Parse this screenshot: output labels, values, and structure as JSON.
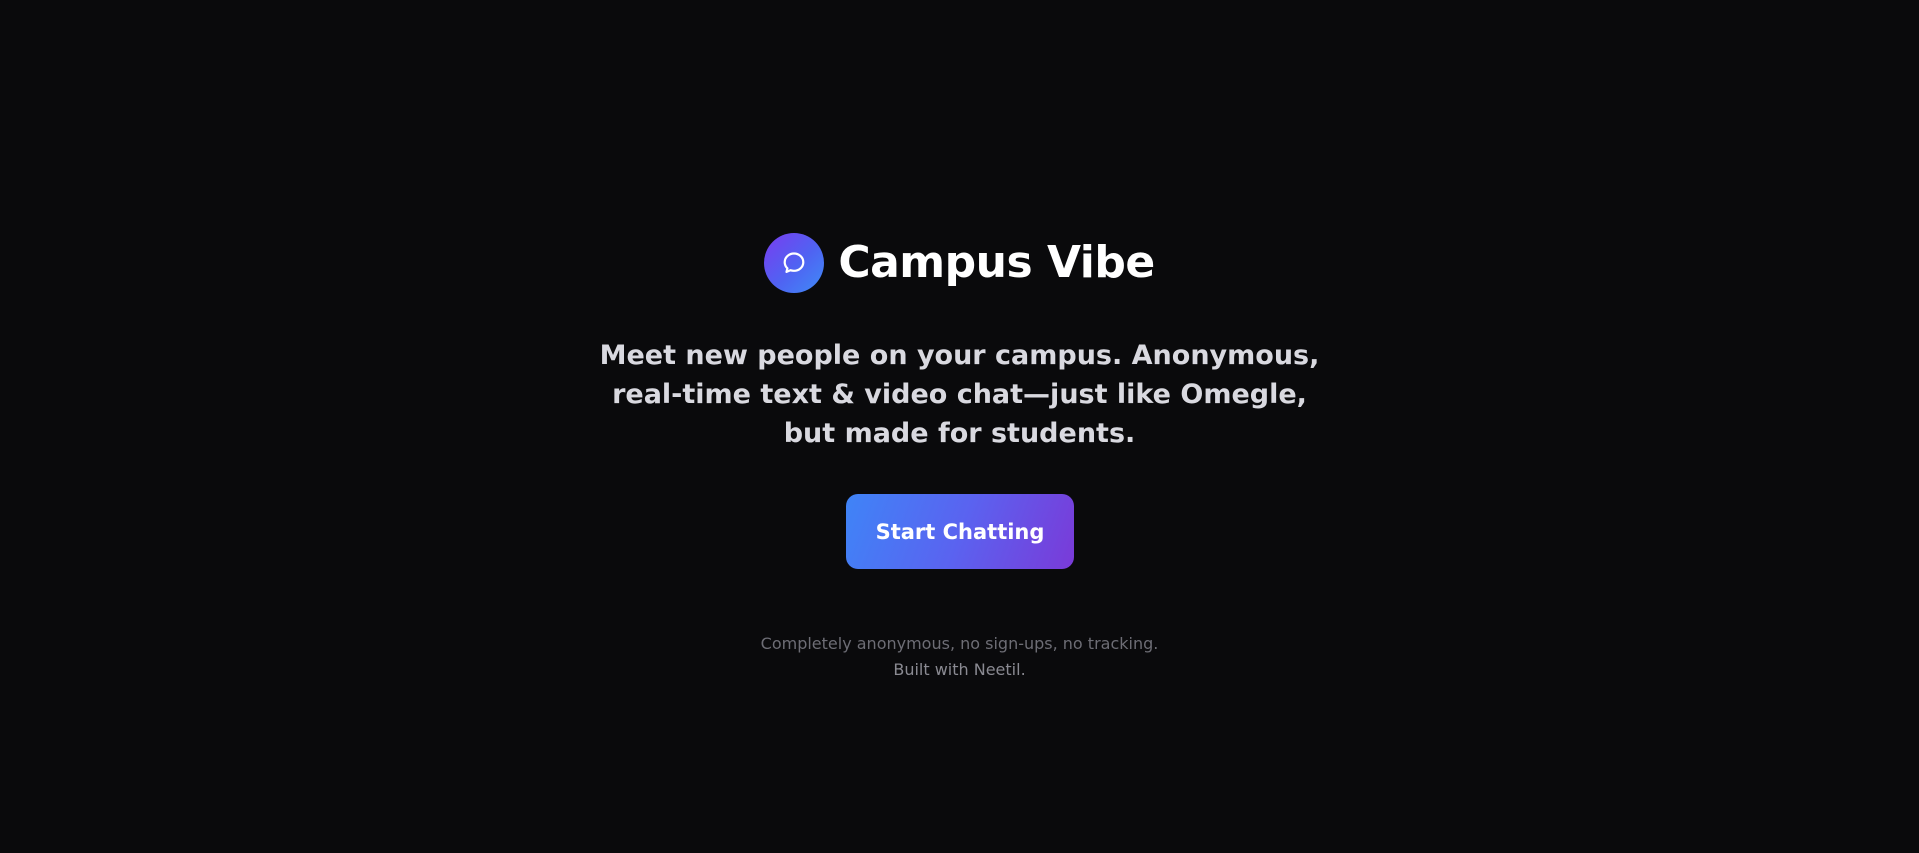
{
  "brand": {
    "title": "Campus Vibe",
    "logo_icon": "chat-bubble-icon"
  },
  "hero": {
    "tagline": "Meet new people on your campus. Anonymous, real-time text & video chat—just like Omegle, but made for students.",
    "cta_label": "Start Chatting"
  },
  "footer": {
    "line1": "Completely anonymous, no sign-ups, no tracking.",
    "line2": "Built with Neetil."
  },
  "colors": {
    "background": "#0a0a0c",
    "accent_blue": "#3f84f7",
    "accent_purple": "#7a3ad8",
    "text_primary": "#ffffff",
    "text_muted": "#6d6d75"
  }
}
